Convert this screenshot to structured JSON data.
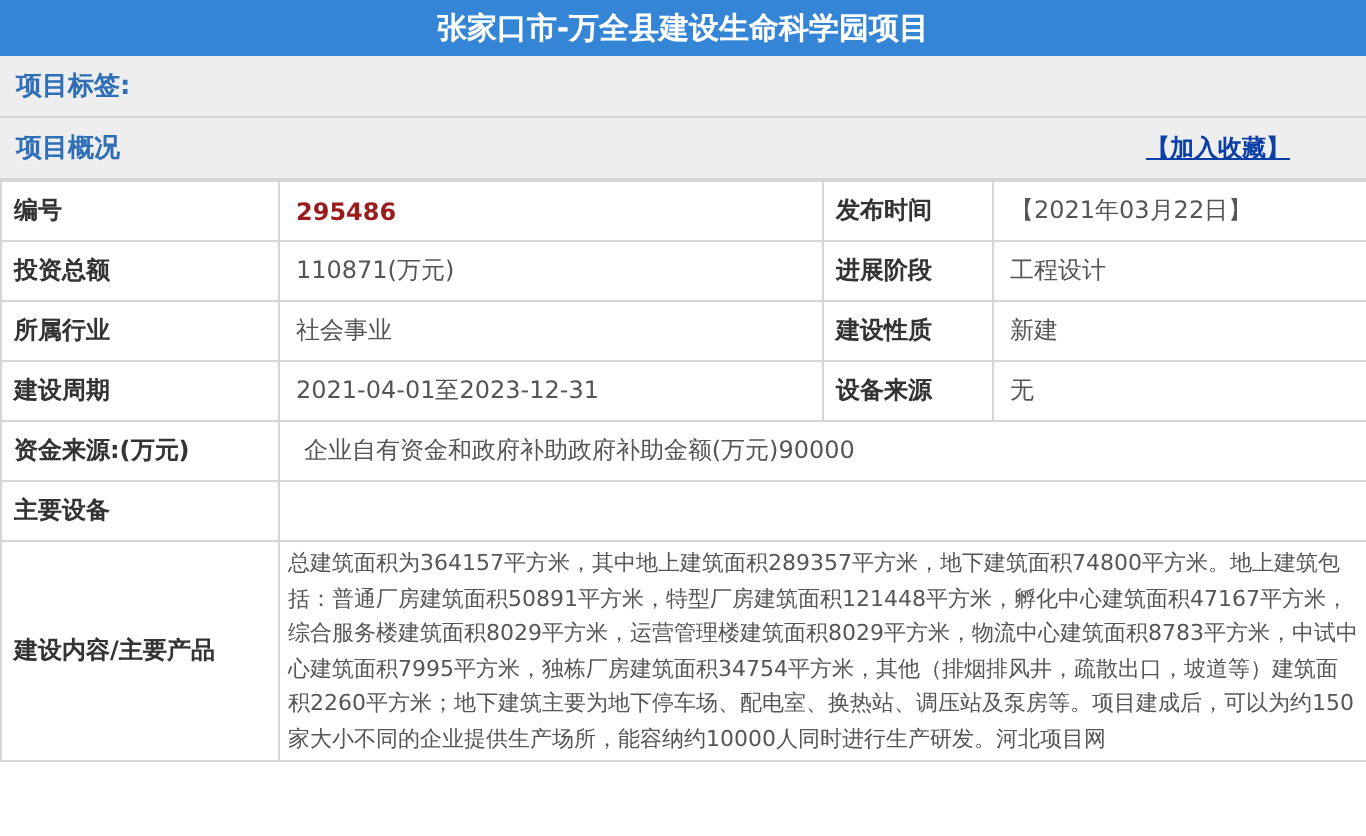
{
  "title": "张家口市-万全县建设生命科学园项目",
  "tags_label": "项目标签:",
  "overview": {
    "label": "项目概况",
    "link": "【加入收藏】"
  },
  "rows": [
    {
      "fields": [
        {
          "label": "编号",
          "value": "295486",
          "kind": "code"
        },
        {
          "label": "发布时间",
          "value": "【2021年03月22日】",
          "kind": "plain"
        }
      ]
    },
    {
      "fields": [
        {
          "label": "投资总额",
          "value": "110871(万元)",
          "kind": "plain"
        },
        {
          "label": "进展阶段",
          "value": "工程设计",
          "kind": "plain"
        }
      ]
    },
    {
      "fields": [
        {
          "label": "所属行业",
          "value": "社会事业",
          "kind": "plain"
        },
        {
          "label": "建设性质",
          "value": "新建",
          "kind": "plain"
        }
      ]
    },
    {
      "fields": [
        {
          "label": "建设周期",
          "value": "2021-04-01至2023-12-31",
          "kind": "plain"
        },
        {
          "label": "设备来源",
          "value": "无",
          "kind": "plain"
        }
      ]
    },
    {
      "fields": [
        {
          "label": "资金来源:(万元)",
          "value": " 企业自有资金和政府补助政府补助金额(万元)90000",
          "kind": "plain"
        }
      ]
    },
    {
      "fields": [
        {
          "label": "主要设备",
          "kind": "plain"
        }
      ]
    },
    {
      "fields": [
        {
          "label": "建设内容/主要产品",
          "value": "总建筑面积为364157平方米，其中地上建筑面积289357平方米，地下建筑面积74800平方米。地上建筑包括：普通厂房建筑面积50891平方米，特型厂房建筑面积121448平方米，孵化中心建筑面积47167平方米，综合服务楼建筑面积8029平方米，运营管理楼建筑面积8029平方米，物流中心建筑面积8783平方米，中试中心建筑面积7995平方米，独栋厂房建筑面积34754平方米，其他（排烟排风井，疏散出口，坡道等）建筑面积2260平方米；地下建筑主要为地下停车场、配电室、换热站、调压站及泵房等。项目建成后，可以为约150家大小不同的企业提供生产场所，能容纳约10000人同时进行生产研发。河北项目网",
          "kind": "long"
        }
      ]
    }
  ]
}
